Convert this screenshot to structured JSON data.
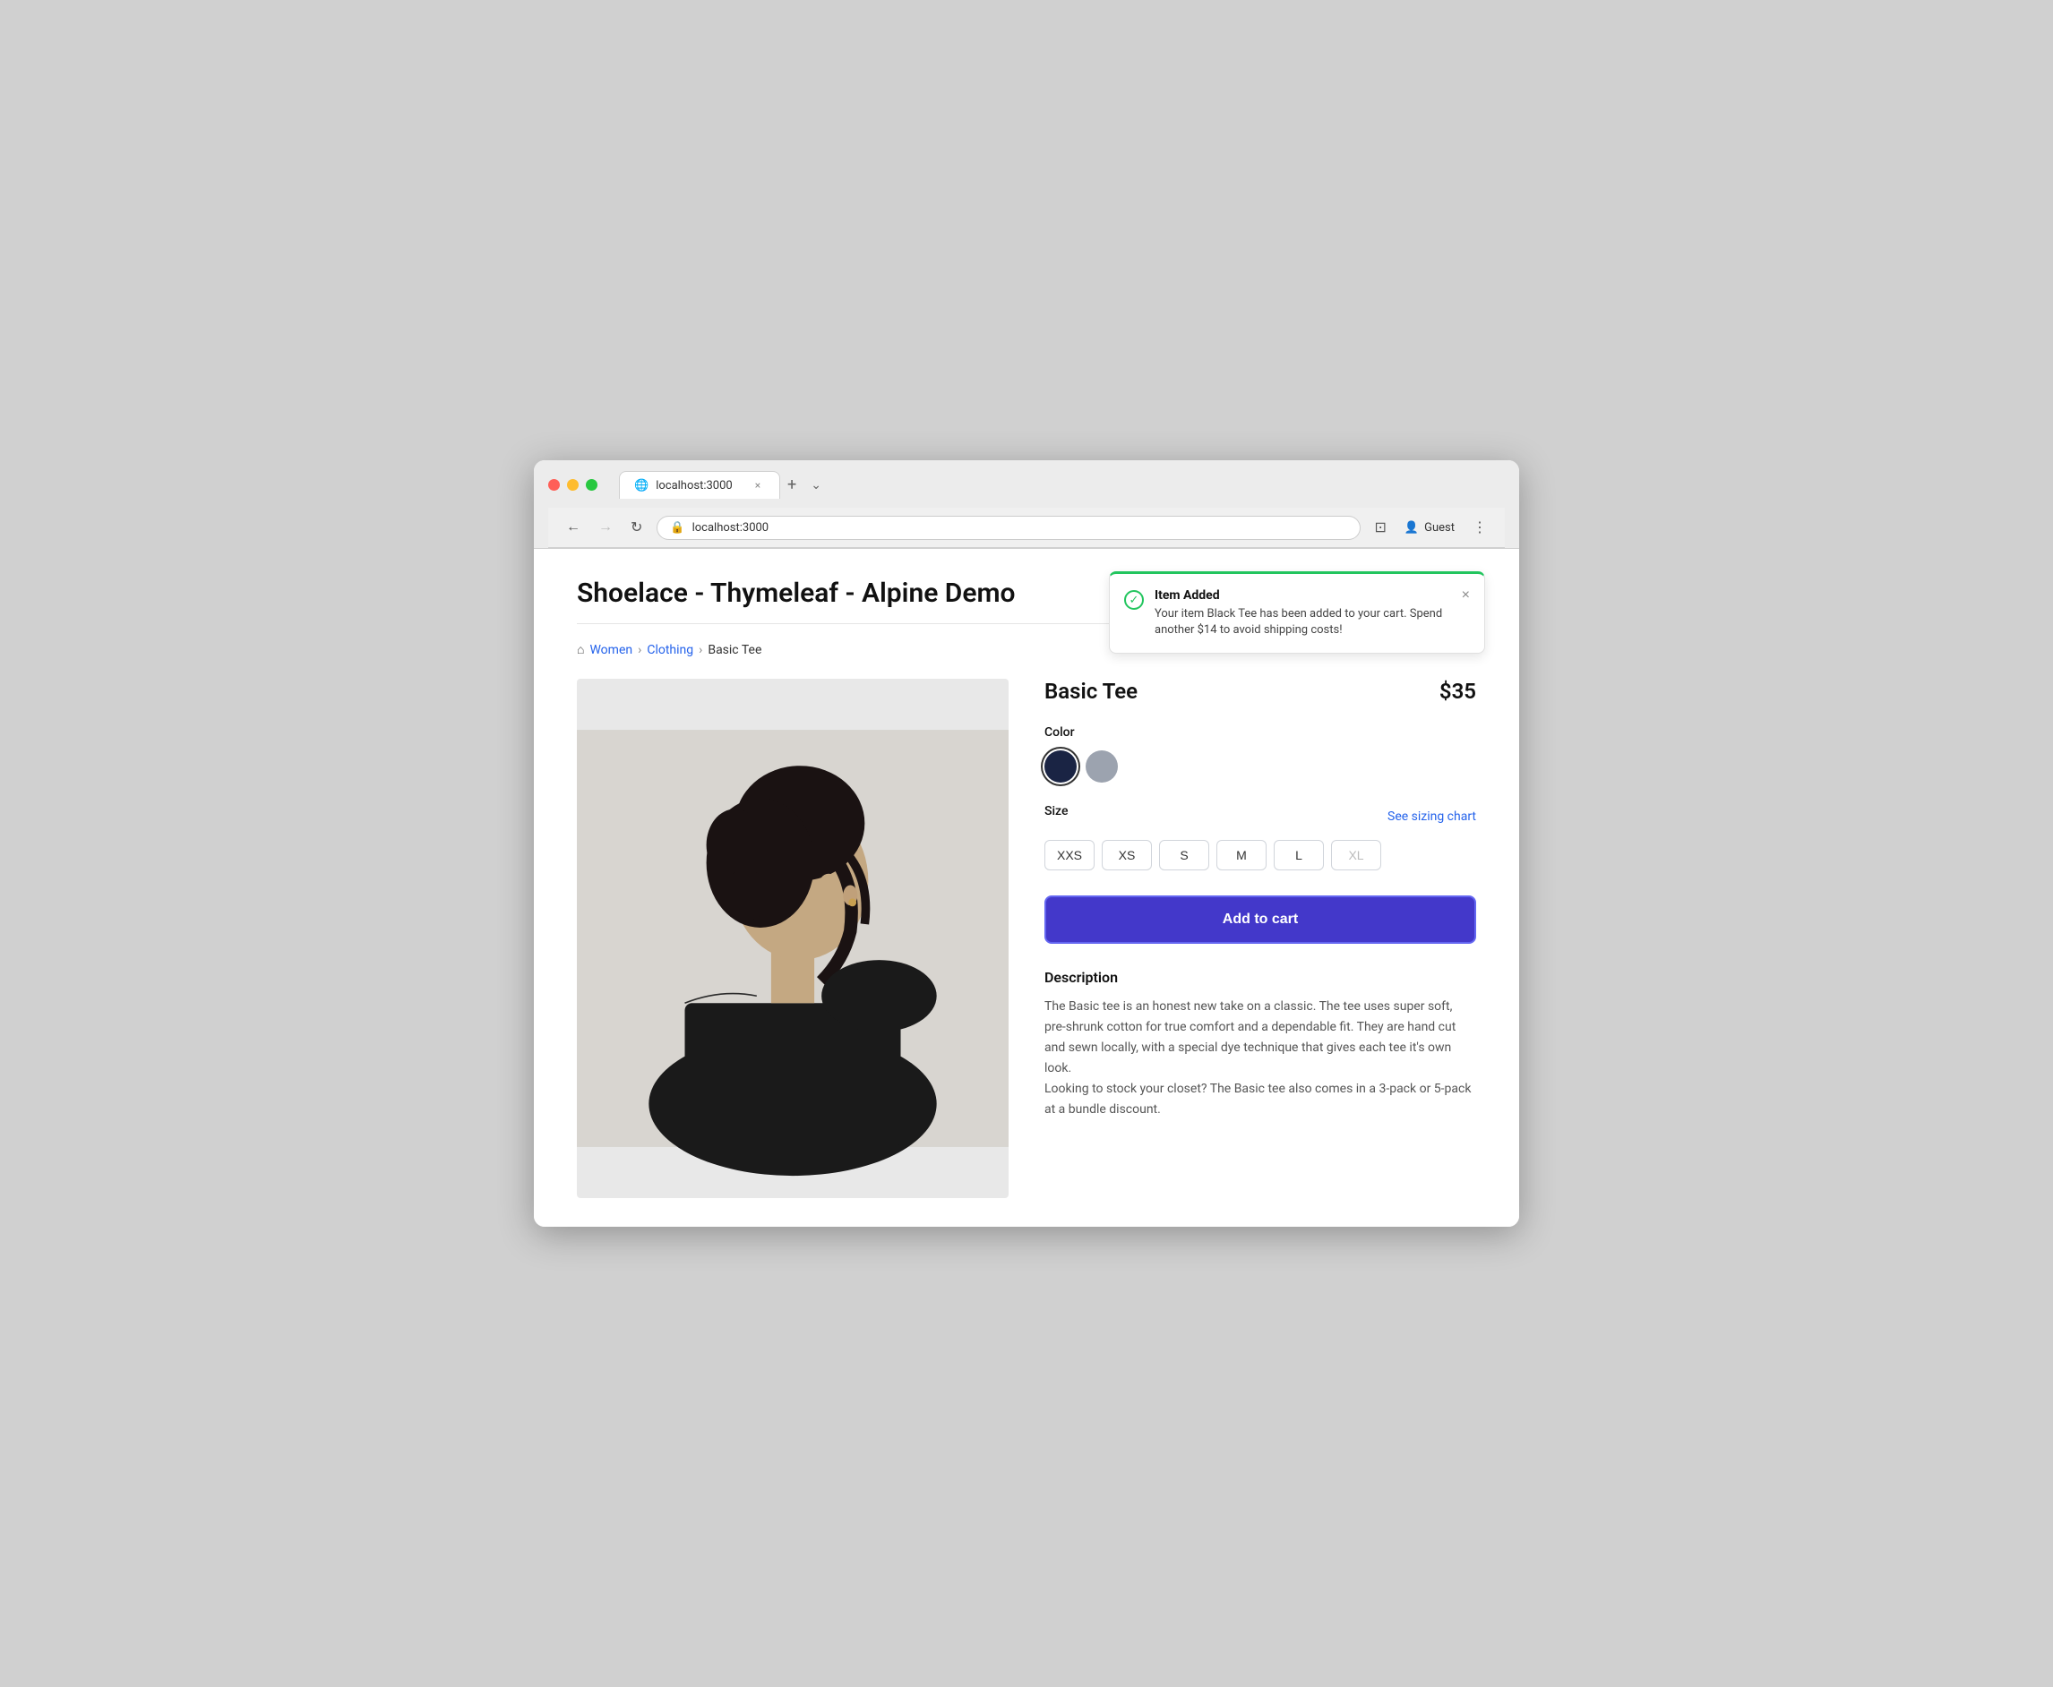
{
  "browser": {
    "url": "localhost:3000",
    "tab_title": "localhost:3000",
    "tab_close_label": "×",
    "tab_new_label": "+",
    "nav_back": "←",
    "nav_forward": "→",
    "nav_refresh": "↻",
    "user_label": "Guest",
    "dropdown_label": "⌄"
  },
  "page": {
    "title": "Shoelace - Thymeleaf - Alpine Demo"
  },
  "breadcrumb": {
    "home_label": "⌂",
    "women_label": "Women",
    "clothing_label": "Clothing",
    "current_label": "Basic Tee",
    "separator": "›"
  },
  "toast": {
    "title": "Item Added",
    "message": "Your item Black Tee has been added to your cart. Spend another $14 to avoid shipping costs!",
    "close_label": "×"
  },
  "product": {
    "name": "Basic Tee",
    "price": "$35",
    "color_label": "Color",
    "size_label": "Size",
    "sizing_chart_label": "See sizing chart",
    "sizes": [
      {
        "label": "XXS",
        "available": true
      },
      {
        "label": "XS",
        "available": true
      },
      {
        "label": "S",
        "available": true
      },
      {
        "label": "M",
        "available": true
      },
      {
        "label": "L",
        "available": true
      },
      {
        "label": "XL",
        "available": false
      }
    ],
    "add_to_cart_label": "Add to cart",
    "description_title": "Description",
    "description_text": "The Basic tee is an honest new take on a classic. The tee uses super soft, pre-shrunk cotton for true comfort and a dependable fit. They are hand cut and sewn locally, with a special dye technique that gives each tee it's own look.\nLooking to stock your closet? The Basic tee also comes in a 3-pack or 5-pack at a bundle discount."
  }
}
